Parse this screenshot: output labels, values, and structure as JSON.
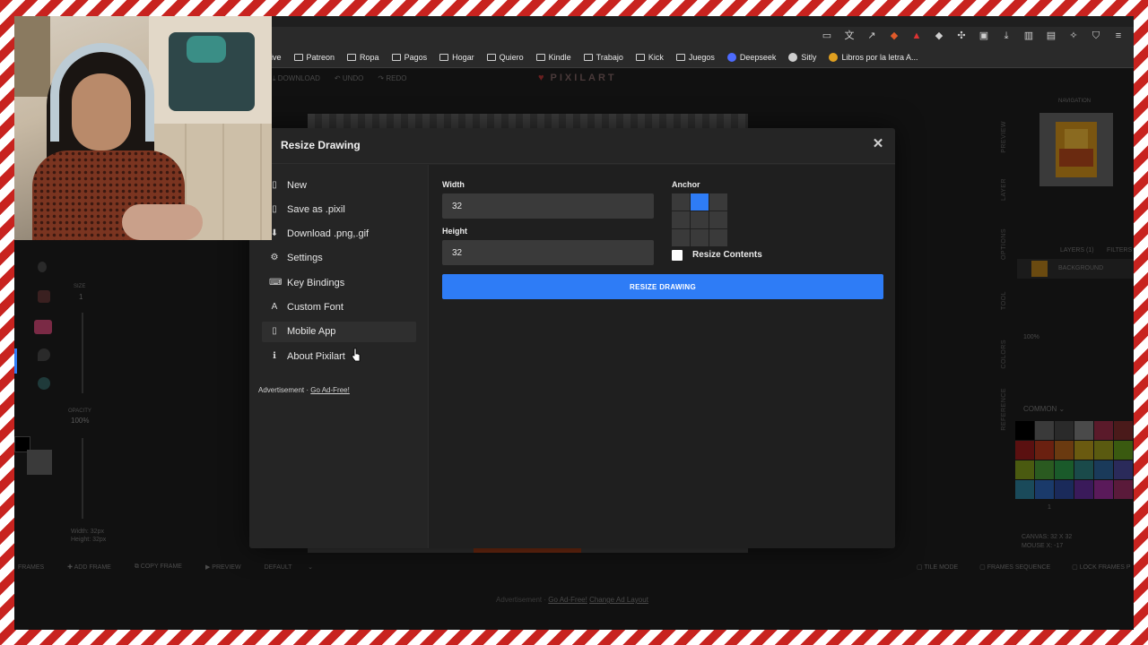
{
  "browser": {
    "bookmarks": [
      {
        "label": "ive",
        "type": "none"
      },
      {
        "label": "Patreon",
        "type": "folder"
      },
      {
        "label": "Ropa",
        "type": "folder"
      },
      {
        "label": "Pagos",
        "type": "folder"
      },
      {
        "label": "Hogar",
        "type": "folder"
      },
      {
        "label": "Quiero",
        "type": "folder"
      },
      {
        "label": "Kindle",
        "type": "folder"
      },
      {
        "label": "Trabajo",
        "type": "folder"
      },
      {
        "label": "Kick",
        "type": "folder"
      },
      {
        "label": "Juegos",
        "type": "folder"
      },
      {
        "label": "Deepseek",
        "type": "deepseek-icon"
      },
      {
        "label": "Sitly",
        "type": "globe-icon"
      },
      {
        "label": "Libros por la letra A...",
        "type": "bookmark-icon"
      }
    ]
  },
  "app": {
    "logo": "PIXILART",
    "top_actions": {
      "download": "DOWNLOAD",
      "undo": "UNDO",
      "redo": "REDO"
    },
    "left": {
      "size_label": "SIZE",
      "size_value": "1",
      "opacity_label": "OPACITY",
      "opacity_value": "100%",
      "width_info": "Width: 32px",
      "height_info": "Height: 32px"
    },
    "bottom_bar": {
      "frames": "FRAMES",
      "add_frame": "ADD FRAME",
      "copy_frame": "COPY FRAME",
      "preview": "PREVIEW",
      "default": "DEFAULT",
      "tile_mode": "TILE MODE",
      "frames_sequence": "FRAMES SEQUENCE",
      "lock_frames": "LOCK FRAMES P"
    },
    "ad_line": {
      "prefix": "Advertisement ·",
      "go_ad_free": "Go Ad-Free!",
      "change": "Change Ad Layout"
    },
    "right": {
      "tabs": [
        "PREVIEW",
        "LAYER",
        "OPTIONS",
        "TOOL",
        "COLORS",
        "REFERENCE"
      ],
      "navigation": "NAVIGATION",
      "layers_count": "LAYERS (1)",
      "filters": "FILTERS",
      "layer_name": "BACKGROUND",
      "zoom": "100%",
      "palette_name": "COMMON",
      "frame_num": "1",
      "canvas_info": "CANVAS: 32 X 32",
      "mouse_info": "MOUSE X: -17",
      "palette_colors": [
        "#000000",
        "#3a3a3a",
        "#2a2a2a",
        "#4a4a4a",
        "#5a1a2a",
        "#4a1a1a",
        "#5a1010",
        "#6a2010",
        "#6a3a10",
        "#6a5a10",
        "#5a5a10",
        "#3a5a10",
        "#4a5a10",
        "#2a5a20",
        "#1a5a2a",
        "#1a4a4a",
        "#1a3a5a",
        "#2a2a5a",
        "#1a4a5a",
        "#1a3a6a",
        "#1a2a5a",
        "#3a1a5a",
        "#5a1a5a",
        "#5a1a3a"
      ]
    }
  },
  "modal": {
    "title": "Resize Drawing",
    "menu": [
      {
        "label": "New",
        "icon": "file-icon",
        "glyph": "▯"
      },
      {
        "label": "Save as .pixil",
        "icon": "file-save-icon",
        "glyph": "▯"
      },
      {
        "label": "Download .png,.gif",
        "icon": "download-icon",
        "glyph": "⬇"
      },
      {
        "label": "Settings",
        "icon": "gears-icon",
        "glyph": "⚙"
      },
      {
        "label": "Key Bindings",
        "icon": "keyboard-icon",
        "glyph": "⌨"
      },
      {
        "label": "Custom Font",
        "icon": "font-icon",
        "glyph": "A"
      },
      {
        "label": "Mobile App",
        "icon": "mobile-icon",
        "glyph": "▯"
      },
      {
        "label": "About Pixilart",
        "icon": "info-icon",
        "glyph": "ℹ"
      }
    ],
    "ad_prefix": "Advertisement ·",
    "ad_link": "Go Ad-Free!",
    "width_label": "Width",
    "width_value": "32",
    "height_label": "Height",
    "height_value": "32",
    "anchor_label": "Anchor",
    "anchor_selected": 1,
    "resize_contents_label": "Resize Contents",
    "resize_button": "RESIZE DRAWING",
    "accent": "#2e7cf6"
  }
}
